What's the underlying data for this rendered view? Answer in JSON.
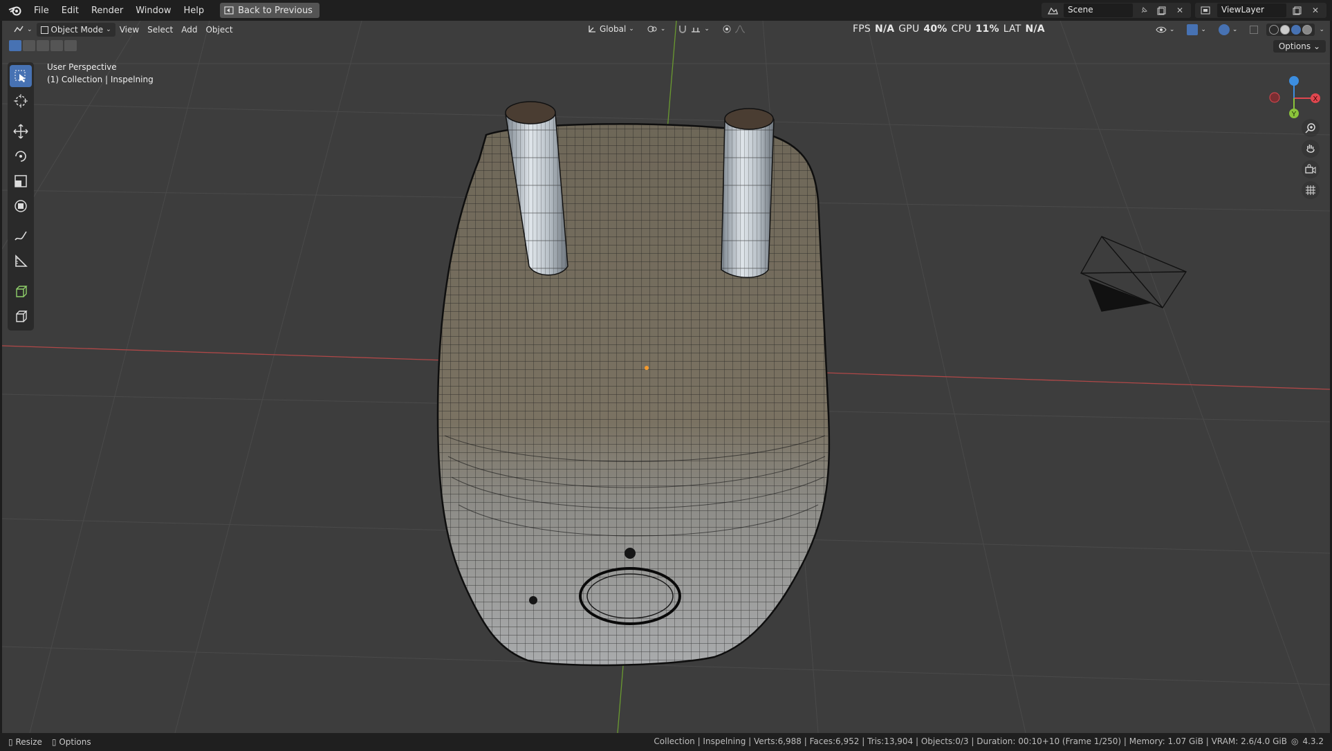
{
  "menu": {
    "items": [
      "File",
      "Edit",
      "Render",
      "Window",
      "Help"
    ],
    "back_button": "Back to Previous"
  },
  "topbar_right": {
    "scene": "Scene",
    "view_layer": "ViewLayer"
  },
  "viewport_header": {
    "mode": "Object Mode",
    "menus": [
      "View",
      "Select",
      "Add",
      "Object"
    ],
    "orientation": "Global",
    "options": "Options"
  },
  "stats": {
    "fps_label": "FPS",
    "fps_value": "N/A",
    "gpu_label": "GPU",
    "gpu_value": "40%",
    "cpu_label": "CPU",
    "cpu_value": "11%",
    "lat_label": "LAT",
    "lat_value": "N/A"
  },
  "viewport_info": {
    "perspective": "User Perspective",
    "collection": "(1) Collection | Inspelning"
  },
  "gizmo": {
    "x": "X",
    "y": "Y",
    "colors": {
      "x": "#e0474f",
      "y": "#8bc43b",
      "z": "#3c8ee0"
    }
  },
  "statusbar": {
    "resize": "Resize",
    "options": "Options",
    "info": "Collection | Inspelning | Verts:6,988 | Faces:6,952 | Tris:13,904 | Objects:0/3 | Duration: 00:10+10 (Frame 1/250) | Memory: 1.07 GiB | VRAM: 2.6/4.0 GiB",
    "version": "4.3.2"
  },
  "colors": {
    "accent": "#4772b3",
    "viewport_bg": "#3d3d3d",
    "x_axis": "#b04848",
    "y_axis": "#6a9a30"
  }
}
